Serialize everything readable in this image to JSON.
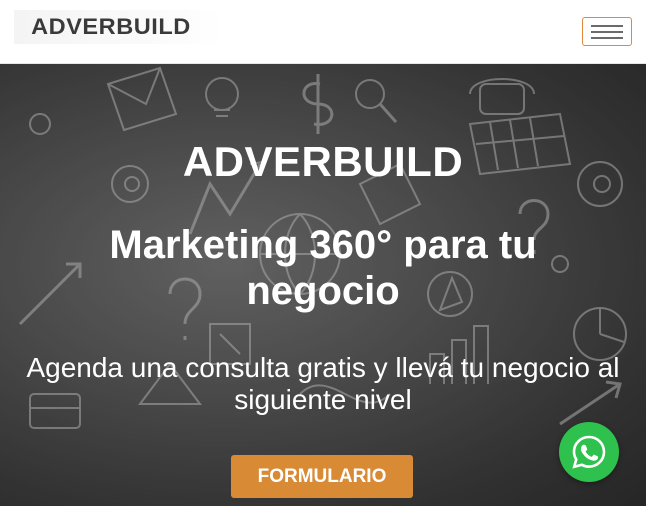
{
  "header": {
    "logo_text": "ADVERBUILD",
    "menu_icon": "hamburger-menu-icon"
  },
  "hero": {
    "title": "ADVERBUILD",
    "subtitle": "Marketing 360° para tu negocio",
    "tagline": "Agenda una consulta gratis y llevá tu negocio al siguiente nivel",
    "cta_label": "FORMULARIO"
  },
  "floating": {
    "whatsapp_icon": "whatsapp-icon"
  },
  "colors": {
    "accent": "#d98a35",
    "whatsapp": "#2fc14d",
    "logo": "#3a3a3a"
  }
}
